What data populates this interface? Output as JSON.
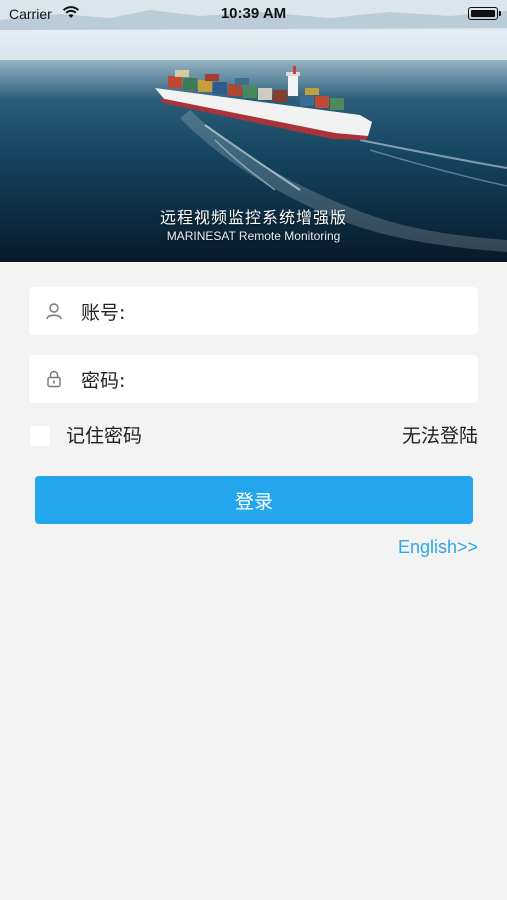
{
  "status_bar": {
    "carrier": "Carrier",
    "time": "10:39 AM",
    "wifi_icon": "wifi-icon",
    "battery_icon": "battery-icon"
  },
  "hero": {
    "title": "远程视频监控系统增强版",
    "subtitle": "MARINESAT Remote Monitoring",
    "image": "container-ship-at-sea"
  },
  "form": {
    "account": {
      "label": "账号:",
      "value": "",
      "icon": "user-icon"
    },
    "password": {
      "label": "密码:",
      "value": "",
      "icon": "lock-icon"
    },
    "remember_label": "记住密码",
    "remember_checked": false,
    "cant_login_label": "无法登陆",
    "login_button_label": "登录",
    "language_link": "English>>"
  },
  "colors": {
    "accent": "#24a6ee",
    "link": "#2ba7ec",
    "background": "#f3f3f3",
    "field_background": "#ffffff"
  }
}
